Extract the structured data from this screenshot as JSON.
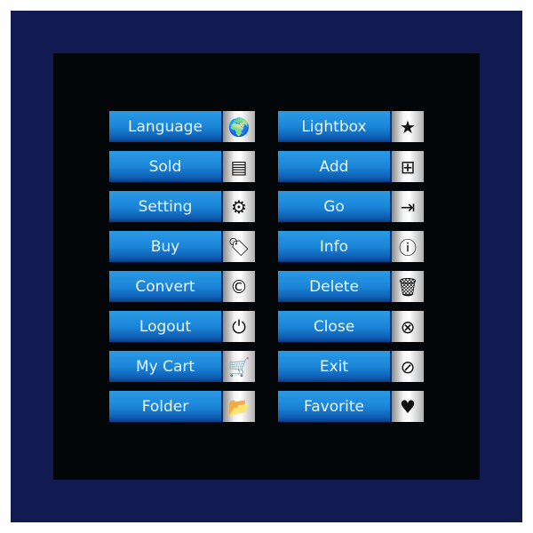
{
  "buttons": [
    {
      "label": "Language",
      "icon": "globe-icon",
      "glyph": "🌍"
    },
    {
      "label": "Sold",
      "icon": "sold-sign-icon",
      "glyph": "▤"
    },
    {
      "label": "Setting",
      "icon": "gear-icon",
      "glyph": "⚙"
    },
    {
      "label": "Buy",
      "icon": "price-tag-icon",
      "glyph": "🏷"
    },
    {
      "label": "Convert",
      "icon": "copyright-icon",
      "glyph": "©"
    },
    {
      "label": "Logout",
      "icon": "power-icon",
      "glyph": "⏻"
    },
    {
      "label": "My Cart",
      "icon": "cart-icon",
      "glyph": "🛒"
    },
    {
      "label": "Folder",
      "icon": "folder-icon",
      "glyph": "📂"
    },
    {
      "label": "Lightbox",
      "icon": "star-icon",
      "glyph": "★"
    },
    {
      "label": "Add",
      "icon": "add-file-icon",
      "glyph": "⊞"
    },
    {
      "label": "Go",
      "icon": "sign-in-icon",
      "glyph": "⇥"
    },
    {
      "label": "Info",
      "icon": "info-icon",
      "glyph": "ⓘ"
    },
    {
      "label": "Delete",
      "icon": "trash-icon",
      "glyph": "🗑"
    },
    {
      "label": "Close",
      "icon": "close-circle-icon",
      "glyph": "⊗"
    },
    {
      "label": "Exit",
      "icon": "no-entry-icon",
      "glyph": "⊘"
    },
    {
      "label": "Favorite",
      "icon": "heart-icon",
      "glyph": "♥"
    }
  ],
  "colors": {
    "frame": "#121a52",
    "panel": "#030608",
    "button": "#1b86d8"
  }
}
